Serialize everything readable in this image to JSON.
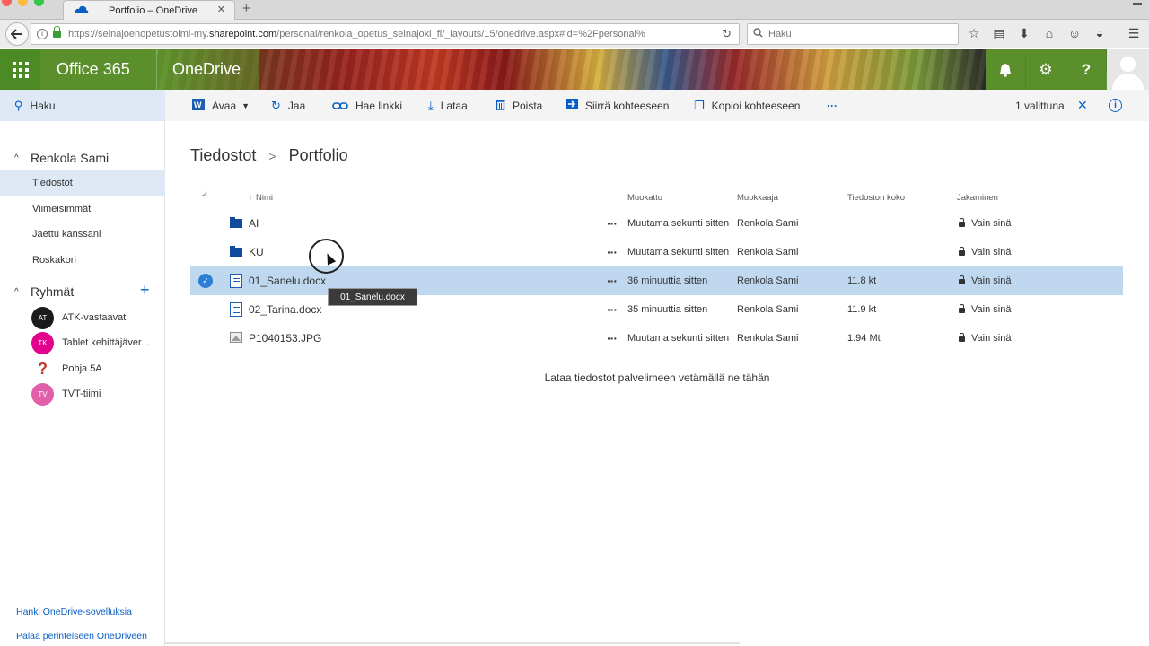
{
  "browser": {
    "tab_title": "Portfolio – OneDrive",
    "url_prefix": "https://seinajoenopetustoimi-my.",
    "url_domain": "sharepoint.com",
    "url_rest": "/personal/renkola_opetus_seinajoki_fi/_layouts/15/onedrive.aspx#id=%2Fpersonal%",
    "search_placeholder": "Haku"
  },
  "header": {
    "suite": "Office 365",
    "app": "OneDrive"
  },
  "commandbar": {
    "search": "Haku",
    "open": "Avaa",
    "share": "Jaa",
    "get_link": "Hae linkki",
    "download": "Lataa",
    "delete": "Poista",
    "move_to": "Siirrä kohteeseen",
    "copy_to": "Kopioi kohteeseen",
    "more": "···",
    "selected_count": "1 valittuna"
  },
  "sidebar": {
    "user": "Renkola Sami",
    "items": [
      {
        "label": "Tiedostot"
      },
      {
        "label": "Viimeisimmät"
      },
      {
        "label": "Jaettu kanssani"
      },
      {
        "label": "Roskakori"
      }
    ],
    "groups_title": "Ryhmät",
    "groups": [
      {
        "label": "ATK-vastaavat",
        "initials": "AT",
        "color": "#1b1b1b"
      },
      {
        "label": "Tablet kehittäjäver...",
        "initials": "TK",
        "color": "#e3008c"
      },
      {
        "label": "Pohja 5A",
        "initials": "",
        "color": "#c0392b"
      },
      {
        "label": "TVT-tiimi",
        "initials": "TV",
        "color": "#e05fa8"
      }
    ],
    "footer_links": [
      "Hanki OneDrive-sovelluksia",
      "Palaa perinteiseen OneDriveen"
    ]
  },
  "breadcrumb": {
    "root": "Tiedostot",
    "current": "Portfolio"
  },
  "columns": {
    "name": "Nimi",
    "modified": "Muokattu",
    "modified_by": "Muokkaaja",
    "size": "Tiedoston koko",
    "sharing": "Jakaminen"
  },
  "files": [
    {
      "name": "AI",
      "modified": "Muutama sekunti sitten",
      "by": "Renkola Sami",
      "size": "",
      "sharing": "Vain sinä"
    },
    {
      "name": "KU",
      "modified": "Muutama sekunti sitten",
      "by": "Renkola Sami",
      "size": "",
      "sharing": "Vain sinä"
    },
    {
      "name": "01_Sanelu.docx",
      "modified": "36 minuuttia sitten",
      "by": "Renkola Sami",
      "size": "11.8 kt",
      "sharing": "Vain sinä"
    },
    {
      "name": "02_Tarina.docx",
      "modified": "35 minuuttia sitten",
      "by": "Renkola Sami",
      "size": "11.9 kt",
      "sharing": "Vain sinä"
    },
    {
      "name": "P1040153.JPG",
      "modified": "Muutama sekunti sitten",
      "by": "Renkola Sami",
      "size": "1.94 Mt",
      "sharing": "Vain sinä"
    }
  ],
  "tooltip": "01_Sanelu.docx",
  "drop_message": "Lataa tiedostot palvelimeen vetämällä ne tähän",
  "colors": {
    "accent": "#0a5fc6",
    "selected_row": "#bfd8ef",
    "suite_green": "#5a8f2c"
  }
}
